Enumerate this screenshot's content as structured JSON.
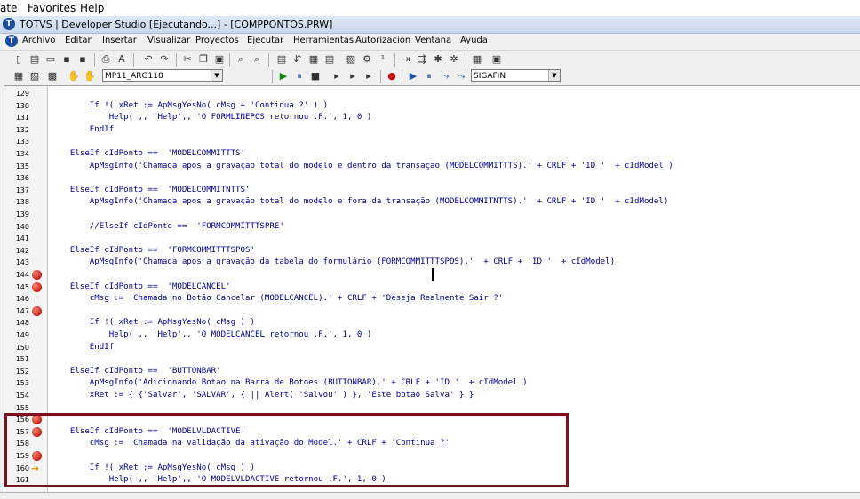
{
  "top_menu": [
    "ate",
    "Favorites",
    "Help"
  ],
  "window_title": "TOTVS | Developer Studio [Ejecutando...] - [COMPPONTOS.PRW]",
  "menubar": [
    "Archivo",
    "Editar",
    "Insertar",
    "Visualizar",
    "Proyectos",
    "Ejecutar",
    "Herramientas",
    "Autorización",
    "Ventana",
    "Ayuda"
  ],
  "toolbar": {
    "environment_combo": "MP11_ARG118",
    "module_combo": "SIGAFIN"
  },
  "code_lines": [
    {
      "n": "129",
      "t": "",
      "m": ""
    },
    {
      "n": "130",
      "t": "        If !( xRet := ApMsgYesNo( cMsg + 'Continua ?' ) )",
      "m": ""
    },
    {
      "n": "131",
      "t": "            Help( ,, 'Help',, 'O FORMLINEPOS retornou .F.', 1, 0 )",
      "m": ""
    },
    {
      "n": "132",
      "t": "        EndIf",
      "m": ""
    },
    {
      "n": "133",
      "t": "",
      "m": ""
    },
    {
      "n": "134",
      "t": "    ElseIf cIdPonto ==  'MODELCOMMITTTS'",
      "m": ""
    },
    {
      "n": "135",
      "t": "        ApMsgInfo('Chamada apos a gravação total do modelo e dentro da transação (MODELCOMMITTTS).' + CRLF + 'ID '  + cIdModel )",
      "m": ""
    },
    {
      "n": "136",
      "t": "",
      "m": ""
    },
    {
      "n": "137",
      "t": "    ElseIf cIdPonto ==  'MODELCOMMITNTTS'",
      "m": ""
    },
    {
      "n": "138",
      "t": "        ApMsgInfo('Chamada apos a gravação total do modelo e fora da transação (MODELCOMMITNTTS).'  + CRLF + 'ID '  + cIdModel)",
      "m": ""
    },
    {
      "n": "139",
      "t": "",
      "m": ""
    },
    {
      "n": "140",
      "t": "        //ElseIf cIdPonto ==  'FORMCOMMITTTSPRE'",
      "m": ""
    },
    {
      "n": "141",
      "t": "",
      "m": ""
    },
    {
      "n": "142",
      "t": "    ElseIf cIdPonto ==  'FORMCOMMITTTSPOS'",
      "m": ""
    },
    {
      "n": "143",
      "t": "        ApMsgInfo('Chamada apos a gravação da tabela do formulário (FORMCOMMITTTSPOS).'  + CRLF + 'ID '  + cIdModel)",
      "m": ""
    },
    {
      "n": "144",
      "t": "",
      "m": "bp"
    },
    {
      "n": "145",
      "t": "    ElseIf cIdPonto ==  'MODELCANCEL'",
      "m": "bp"
    },
    {
      "n": "146",
      "t": "        cMsg := 'Chamada no Botão Cancelar (MODELCANCEL).' + CRLF + 'Deseja Realmente Sair ?'",
      "m": ""
    },
    {
      "n": "147",
      "t": "",
      "m": "bp"
    },
    {
      "n": "148",
      "t": "        If !( xRet := ApMsgYesNo( cMsg ) )",
      "m": ""
    },
    {
      "n": "149",
      "t": "            Help( ,, 'Help',, 'O MODELCANCEL retornou .F.', 1, 0 )",
      "m": ""
    },
    {
      "n": "150",
      "t": "        EndIf",
      "m": ""
    },
    {
      "n": "151",
      "t": "",
      "m": ""
    },
    {
      "n": "152",
      "t": "    ElseIf cIdPonto ==  'BUTTONBAR'",
      "m": ""
    },
    {
      "n": "153",
      "t": "        ApMsgInfo('Adicionando Botao na Barra de Botoes (BUTTONBAR).' + CRLF + 'ID '  + cIdModel )",
      "m": ""
    },
    {
      "n": "154",
      "t": "        xRet := { {'Salvar', 'SALVAR', { || Alert( 'Salvou' ) }, 'Este botao Salva' } }",
      "m": ""
    },
    {
      "n": "155",
      "t": "",
      "m": ""
    },
    {
      "n": "156",
      "t": "",
      "m": "bp"
    },
    {
      "n": "157",
      "t": "    ElseIf cIdPonto ==  'MODELVLDACTIVE'",
      "m": "bp"
    },
    {
      "n": "158",
      "t": "        cMsg := 'Chamada na validação da ativação do Model.' + CRLF + 'Continua ?'",
      "m": ""
    },
    {
      "n": "159",
      "t": "",
      "m": "bp"
    },
    {
      "n": "160",
      "t": "        If !( xRet := ApMsgYesNo( cMsg ) )",
      "m": "arrow"
    },
    {
      "n": "161",
      "t": "            Help( ,, 'Help',, 'O MODELVLDACTIVE retornou .F.', 1, 0 )",
      "m": ""
    }
  ]
}
